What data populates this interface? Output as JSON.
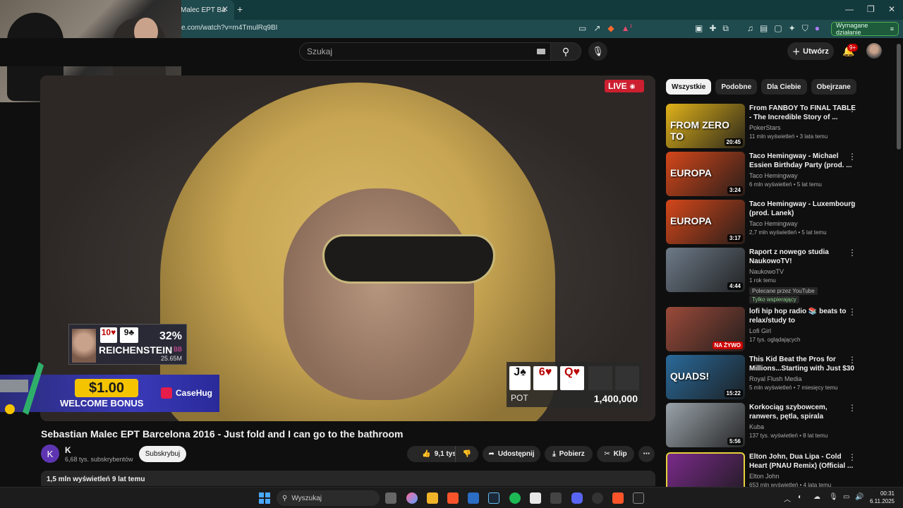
{
  "browser": {
    "tab_title": "Malec EPT Ba",
    "url": "e.com/watch?v=m4TmulRq9BI",
    "action_required": "Wymagane działanie",
    "ext_badge": "1"
  },
  "header": {
    "search_placeholder": "Szukaj",
    "create_label": "Utwórz",
    "notif_count": "9+"
  },
  "video": {
    "live_label": "LIVE",
    "player_name": "REICHENSTEIN",
    "player_pct": "32%",
    "player_bb": "BB",
    "player_stack": "25.65M",
    "player_cards": [
      "10♥",
      "9♣"
    ],
    "board_cards": [
      "J♠",
      "6♥",
      "Q♥"
    ],
    "pot_label": "POT",
    "pot_value": "1,400,000",
    "bonus_amount": "$1.00",
    "bonus_text": "WELCOME BONUS",
    "sponsor": "CaseHug"
  },
  "meta": {
    "title": "Sebastian Malec EPT Barcelona 2016 - Just fold and I can go to the bathroom",
    "channel_initial": "K",
    "channel_name": "K",
    "subscribers": "6,68 tys. subskrybentów",
    "subscribe_label": "Subskrybuj",
    "likes": "9,1 tys.",
    "share_label": "Udostępnij",
    "download_label": "Pobierz",
    "clip_label": "Klip",
    "views_line": "1,5 mln wyświetleń  9 lat temu"
  },
  "chips": [
    "Wszystkie",
    "Podobne",
    "Dla Ciebie",
    "Obejrzane"
  ],
  "recommendations": [
    {
      "title": "From FANBOY To FINAL TABLE - The Incredible Story of ...",
      "channel": "PokerStars",
      "meta": "11 mln wyświetleń • 3 lata temu",
      "duration": "20:45",
      "thumb_text": "FROM ZERO TO",
      "thumb_color": "#e0b21a"
    },
    {
      "title": "Taco Hemingway - Michael Essien Birthday Party (prod. ...",
      "channel": "Taco Hemingway",
      "meta": "6 mln wyświetleń • 5 lat temu",
      "duration": "3:24",
      "thumb_text": "EUROPA",
      "thumb_color": "#d4471a"
    },
    {
      "title": "Taco Hemingway - Luxembourg (prod. Lanek)",
      "channel": "Taco Hemingway",
      "meta": "2,7 mln wyświetleń • 5 lat temu",
      "duration": "3:17",
      "thumb_text": "EUROPA",
      "thumb_color": "#d4471a"
    },
    {
      "title": "Raport z nowego studia NaukowoTV!",
      "channel": "NaukowoTV",
      "meta": "1 rok temu",
      "duration": "4:44",
      "thumb_text": "",
      "thumb_color": "#6d7a88",
      "tag1": "Polecane przez YouTube",
      "tag2": "Tylko wspierający"
    },
    {
      "title": "lofi hip hop radio 📚 beats to relax/study to",
      "channel": "Lofi Girl",
      "meta": "17 tys. oglądających",
      "duration": "NA ŻYWO",
      "thumb_text": "",
      "thumb_color": "#9b4a3a"
    },
    {
      "title": "This Kid Beat the Pros for Millions...Starting with Just $30",
      "channel": "Royal Flush Media",
      "meta": "5 mln wyświetleń • 7 miesięcy temu",
      "duration": "15:22",
      "thumb_text": "QUADS!",
      "thumb_color": "#2a6a9a"
    },
    {
      "title": "Korkociąg szybowcem, ranwers, pętla, spirala",
      "channel": "Kuba",
      "meta": "137 tys. wyświetleń • 8 lat temu",
      "duration": "5:56",
      "thumb_text": "",
      "thumb_color": "#9aa3aa"
    },
    {
      "title": "Elton John, Dua Lipa - Cold Heart (PNAU Remix) (Official ...",
      "channel": "Elton John",
      "meta": "653 mln wyświetleń • 4 lata temu",
      "duration": "",
      "thumb_text": "",
      "thumb_color": "#7a2a8a"
    }
  ],
  "taskbar": {
    "search": "Wyszukaj",
    "time": "00:31",
    "date": "6.11.2025"
  }
}
